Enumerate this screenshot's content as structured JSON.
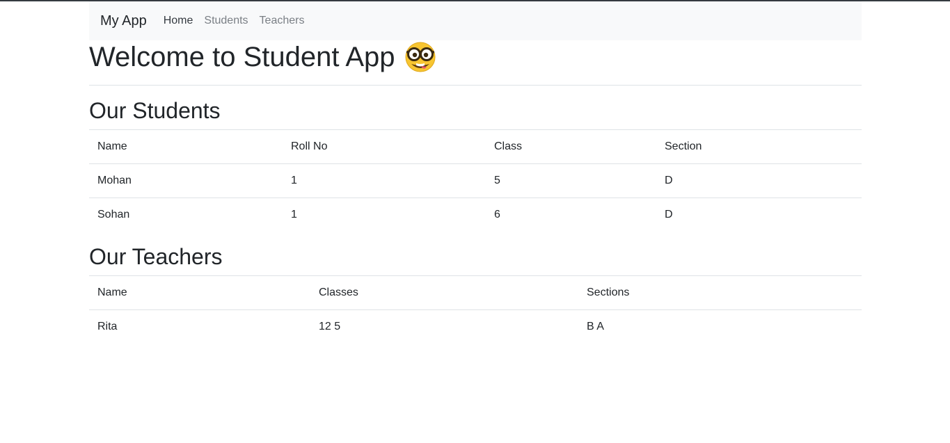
{
  "nav": {
    "brand": "My App",
    "links": [
      "Home",
      "Students",
      "Teachers"
    ]
  },
  "welcome": {
    "title": "Welcome to Student App",
    "emoji_icon": "nerd-face-icon"
  },
  "students": {
    "heading": "Our Students",
    "columns": [
      "Name",
      "Roll No",
      "Class",
      "Section"
    ],
    "rows": [
      [
        "Mohan",
        "1",
        "5",
        "D"
      ],
      [
        "Sohan",
        "1",
        "6",
        "D"
      ]
    ]
  },
  "teachers": {
    "heading": "Our Teachers",
    "columns": [
      "Name",
      "Classes",
      "Sections"
    ],
    "rows": [
      [
        "Rita",
        "12 5",
        "B A"
      ]
    ]
  },
  "colors": {
    "navbar_bg": "#f8f9fa",
    "text": "#212529",
    "muted_link": "#7a7f85",
    "border": "#dee2e6"
  }
}
